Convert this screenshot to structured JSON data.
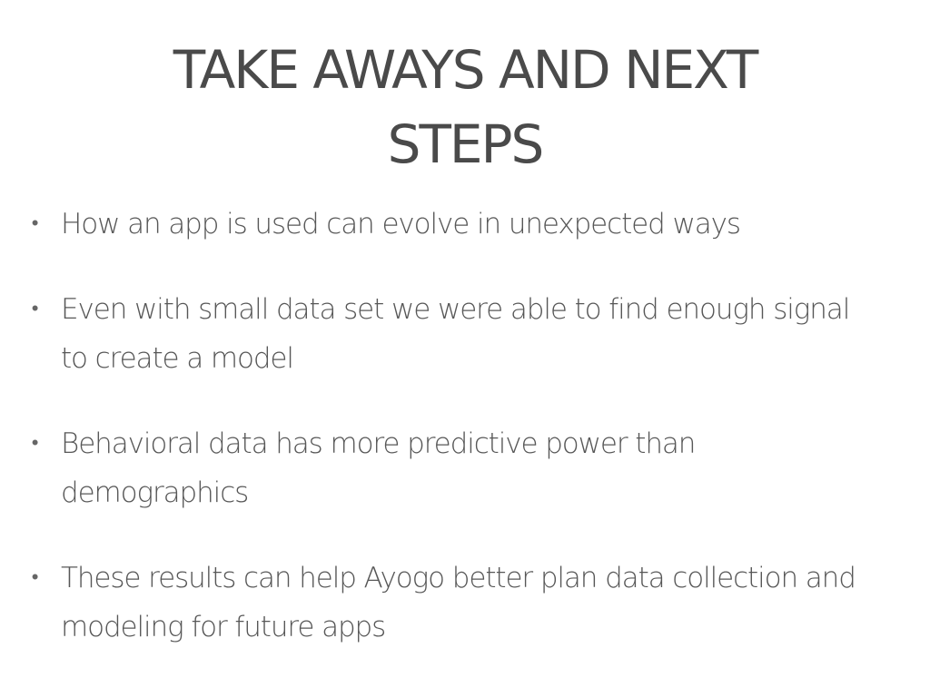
{
  "slide": {
    "title_line1": "TAKE AWAYS AND NEXT",
    "title_line2": "STEPS",
    "bullets": [
      {
        "text": "How an app is used can evolve in unexpected ways"
      },
      {
        "text": "Even with small data set we were able to find enough signal to create a model"
      },
      {
        "text": "Behavioral data has more predictive power than demographics"
      },
      {
        "text": "These results can help Ayogo better plan data collection and modeling for future apps"
      }
    ]
  }
}
